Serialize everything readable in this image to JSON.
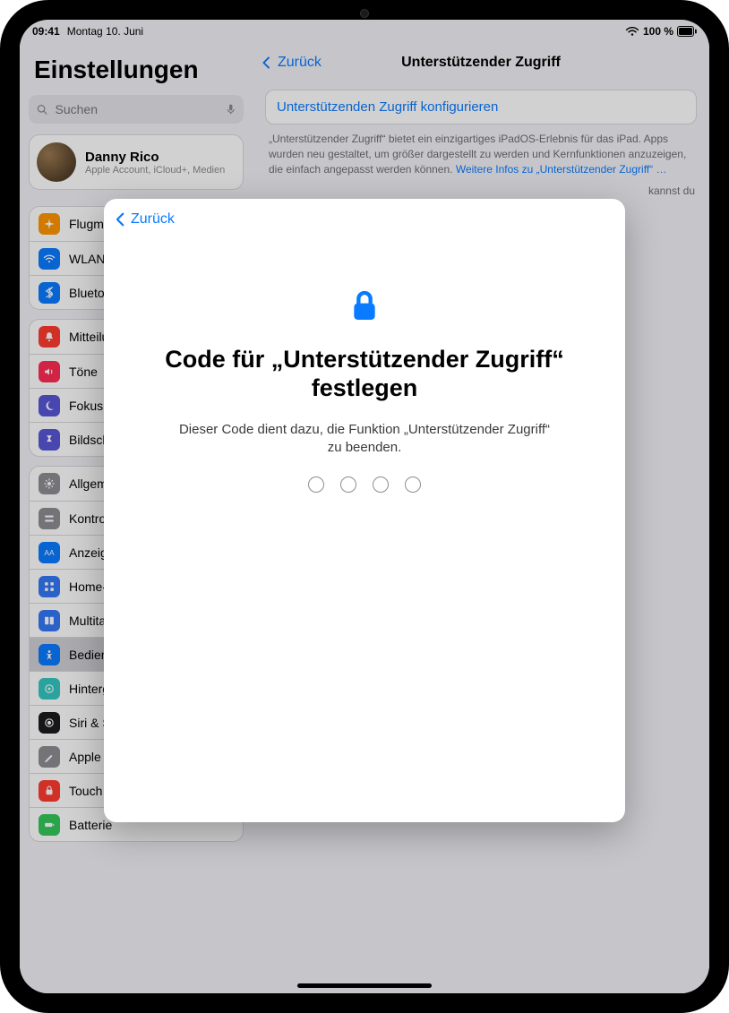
{
  "status": {
    "time": "09:41",
    "date": "Montag 10. Juni",
    "battery": "100 %"
  },
  "sidebar": {
    "title": "Einstellungen",
    "search_placeholder": "Suchen",
    "profile": {
      "name": "Danny Rico",
      "subtitle": "Apple Account, iCloud+, Medien"
    },
    "groups": [
      {
        "items": [
          {
            "label": "Flugmodus",
            "icon": "airplane",
            "color": "#ff9500"
          },
          {
            "label": "WLAN",
            "icon": "wifi",
            "color": "#0a7aff"
          },
          {
            "label": "Bluetooth",
            "icon": "bluetooth",
            "color": "#0a7aff"
          }
        ]
      },
      {
        "items": [
          {
            "label": "Mitteilungen",
            "icon": "bell",
            "color": "#ff3b30"
          },
          {
            "label": "Töne",
            "icon": "speaker",
            "color": "#ff2d55"
          },
          {
            "label": "Fokus",
            "icon": "moon",
            "color": "#5856d6"
          },
          {
            "label": "Bildschirmzeit",
            "icon": "hourglass",
            "color": "#5856d6"
          }
        ]
      },
      {
        "items": [
          {
            "label": "Allgemein",
            "icon": "gear",
            "color": "#8e8e93"
          },
          {
            "label": "Kontrollzentrum",
            "icon": "switches",
            "color": "#8e8e93"
          },
          {
            "label": "Anzeige & Helligkeit",
            "icon": "sun",
            "color": "#0a7aff"
          },
          {
            "label": "Home-Bildschirm & App-Mediathek",
            "icon": "grid",
            "color": "#3478f6"
          },
          {
            "label": "Multitasking & Gesten",
            "icon": "multitask",
            "color": "#3478f6"
          },
          {
            "label": "Bedienungshilfen",
            "icon": "accessibility",
            "color": "#0a7aff",
            "selected": true
          },
          {
            "label": "Hintergrundbild",
            "icon": "wallpaper",
            "color": "#34c7c2"
          },
          {
            "label": "Siri & Suchen",
            "icon": "siri",
            "color": "#1c1c1e"
          },
          {
            "label": "Apple Pencil",
            "icon": "pencil",
            "color": "#8e8e93"
          },
          {
            "label": "Touch ID & Code",
            "icon": "fingerprint",
            "color": "#ff3b30"
          },
          {
            "label": "Batterie",
            "icon": "battery",
            "color": "#34c759"
          }
        ]
      }
    ]
  },
  "detail": {
    "back": "Zurück",
    "title": "Unterstützender Zugriff",
    "config_label": "Unterstützenden Zugriff konfigurieren",
    "info_text": "„Unterstützender Zugriff“ bietet ein einzigartiges iPadOS-Erlebnis für das iPad. Apps wurden neu gestaltet, um größer dargestellt zu werden und Kernfunktionen anzuzeigen, die einfach angepasst werden können.",
    "info_link": "Weitere Infos zu „Unterstützender Zugriff“ …",
    "info_tail": "kannst du"
  },
  "modal": {
    "back": "Zurück",
    "title": "Code für „Unterstützender Zugriff“ festlegen",
    "subtitle": "Dieser Code dient dazu, die Funktion „Unterstützender Zugriff“ zu beenden.",
    "digits": 4
  }
}
